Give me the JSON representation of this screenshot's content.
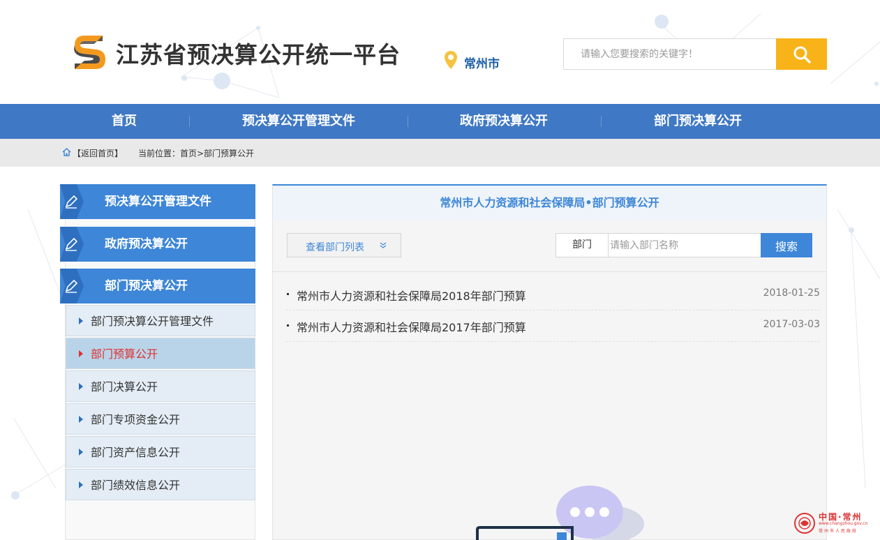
{
  "site": {
    "title": "江苏省预决算公开统一平台",
    "city": "常州市"
  },
  "search": {
    "placeholder": "请输入您要搜索的关键字！"
  },
  "nav": {
    "items": [
      {
        "label": "首页"
      },
      {
        "label": "预决算公开管理文件"
      },
      {
        "label": "政府预决算公开"
      },
      {
        "label": "部门预决算公开"
      }
    ]
  },
  "breadcrumb": {
    "back": "【返回首页】",
    "position": "当前位置：首页>部门预算公开"
  },
  "sidebar": {
    "heads": [
      {
        "label": "预决算公开管理文件"
      },
      {
        "label": "政府预决算公开"
      },
      {
        "label": "部门预决算公开"
      }
    ],
    "subs": [
      {
        "label": "部门预决算公开管理文件",
        "active": false
      },
      {
        "label": "部门预算公开",
        "active": true
      },
      {
        "label": "部门决算公开",
        "active": false
      },
      {
        "label": "部门专项资金公开",
        "active": false
      },
      {
        "label": "部门资产信息公开",
        "active": false
      },
      {
        "label": "部门绩效信息公开",
        "active": false
      }
    ]
  },
  "main": {
    "title": "常州市人力资源和社会保障局•部门预算公开",
    "dept_list_button": "查看部门列表",
    "dept_label": "部门",
    "dept_placeholder": "请输入部门名称",
    "search_button": "搜索",
    "rows": [
      {
        "title": "常州市人力资源和社会保障局2018年部门预算",
        "date": "2018-01-25"
      },
      {
        "title": "常州市人力资源和社会保障局2017年部门预算",
        "date": "2017-03-03"
      }
    ]
  },
  "footer_badge": {
    "name": "中国·常州",
    "url": "www.changzhou.gov.cn",
    "gov": "常州市人民政府"
  },
  "colors": {
    "nav": "#3f78c4",
    "accent": "#3e86d8",
    "search_button": "#f8b318",
    "active_sub": "#e03030"
  },
  "icons": {
    "logo": "s-logo-icon",
    "location": "location-pin-icon",
    "search": "magnifier-icon",
    "home": "home-icon",
    "pen": "pen-icon",
    "chevron": "double-chevron-down-icon"
  }
}
